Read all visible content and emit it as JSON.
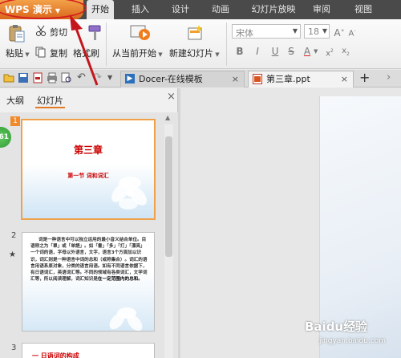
{
  "app": {
    "name": "WPS 演示"
  },
  "menu": {
    "items": [
      "开始",
      "插入",
      "设计",
      "动画",
      "幻灯片放映",
      "审阅",
      "视图"
    ]
  },
  "ribbon": {
    "paste": "粘贴",
    "cut": "剪切",
    "copy": "复制",
    "format_painter": "格式刷",
    "from_current": "从当前开始",
    "new_slide": "新建幻灯片",
    "font_name": "宋体",
    "font_size": "18"
  },
  "tabs": {
    "docer": "Docer-在线模板",
    "file": "第三章.ppt"
  },
  "panel": {
    "tab_outline": "大纲",
    "tab_slides": "幻灯片",
    "badge": "61"
  },
  "slides": [
    {
      "num": "1",
      "title": "第三章",
      "subtitle": "第一节 词和词汇"
    },
    {
      "num": "2",
      "body": "词是一种语言中可以独立运用的最小音义结合单位。目语称之为「單」或「单語」。如「書」「多」「打」「漂亮」一个词的语，字母以外语言，文字，语言3个方面加以识识，词汇则是一种语言中词的总和（或称集合）。词汇的语言用语系原对象，分类的语言用语。如有不同语言依据下，有日语词汇，英语词汇等。不同的领域有各类词汇，文学词汇等，所以阅读理解，词汇知识是",
      "emphasis": "在一定范围内的总和。"
    },
    {
      "num": "3",
      "heading": "一 日语词的构成"
    }
  ],
  "watermark": {
    "site": "Baidu经验",
    "url": "jingyan.baidu.com"
  },
  "colors": {
    "accent": "#e47a24",
    "title_red": "#cc0000",
    "menubar": "#4a4a4a"
  }
}
